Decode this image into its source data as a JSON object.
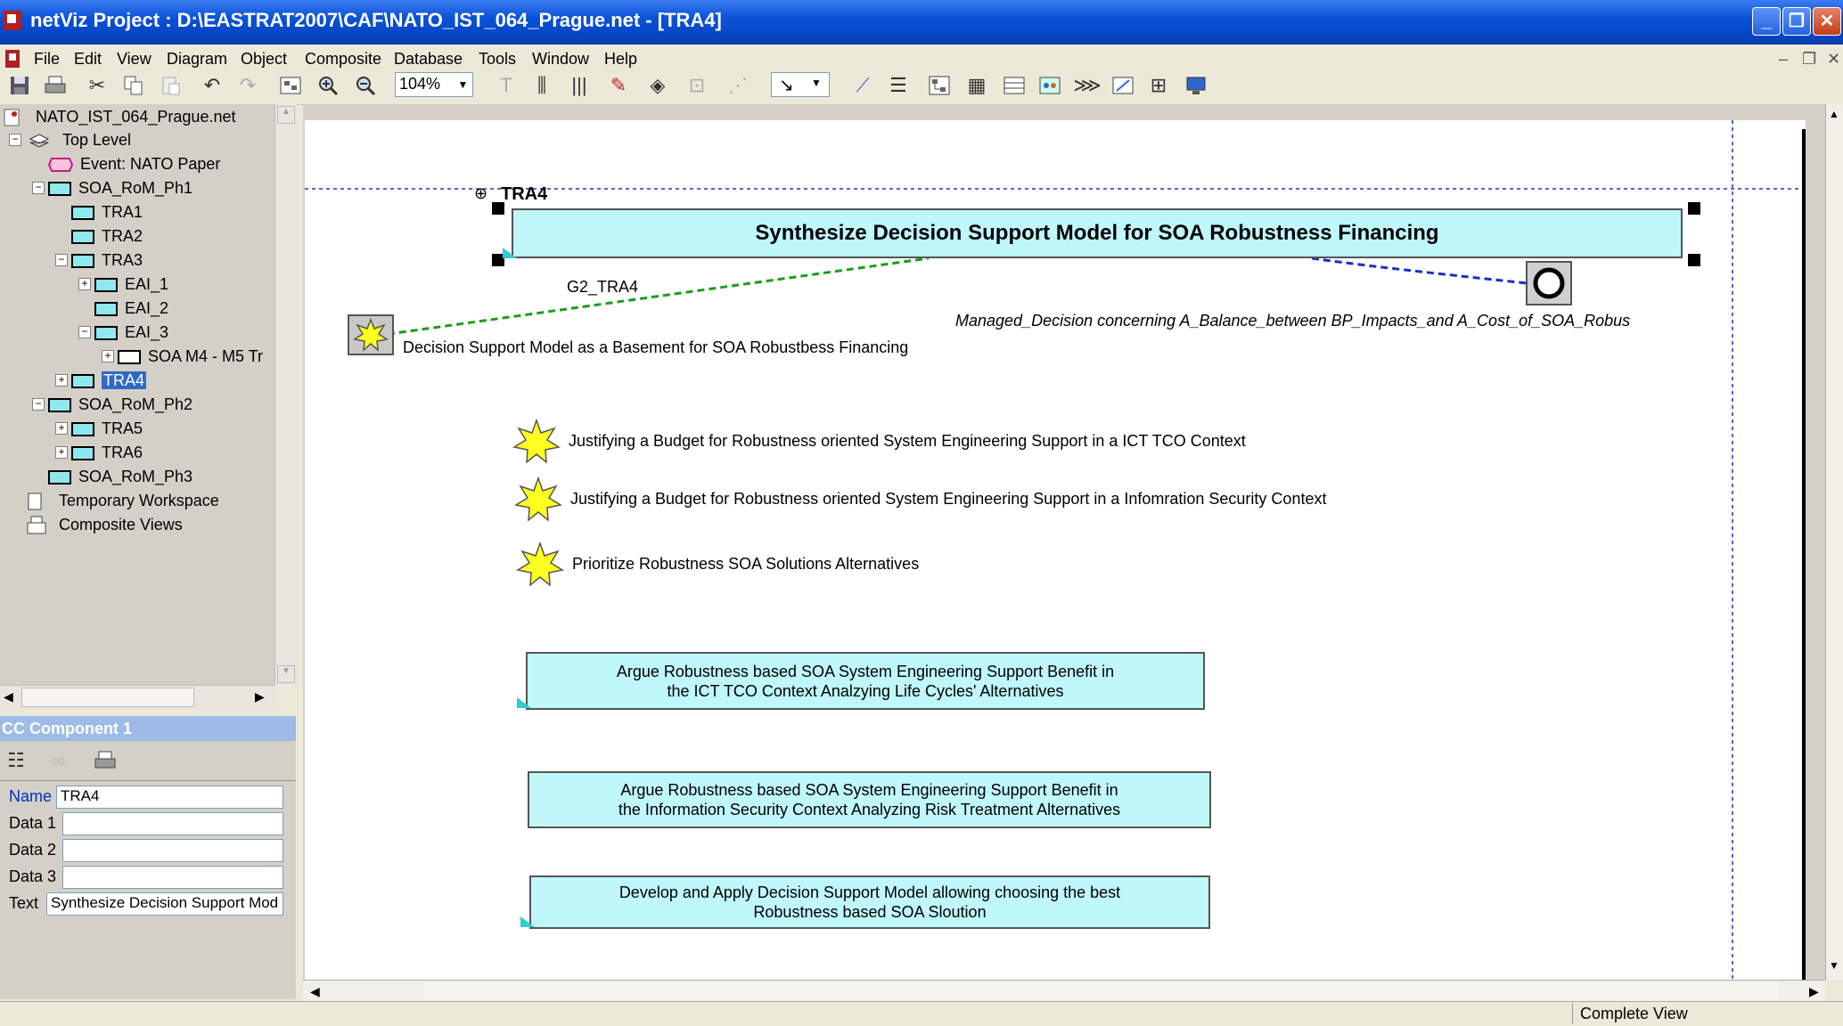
{
  "window": {
    "title": "netViz Project : D:\\EASTRAT2007\\CAF\\NATO_IST_064_Prague.net - [TRA4]",
    "controls": [
      "_",
      "❐",
      "✕"
    ]
  },
  "menu": [
    "File",
    "Edit",
    "View",
    "Diagram",
    "Object",
    "Composite",
    "Database",
    "Tools",
    "Window",
    "Help"
  ],
  "mdi_controls": [
    "–",
    "❐",
    "✕"
  ],
  "toolbar": {
    "zoom": "104%"
  },
  "tree": {
    "root": "NATO_IST_064_Prague.net",
    "items": [
      {
        "label": "Top Level"
      },
      {
        "label": "Event: NATO Paper"
      },
      {
        "label": "SOA_RoM_Ph1"
      },
      {
        "label": "TRA1"
      },
      {
        "label": "TRA2"
      },
      {
        "label": "TRA3"
      },
      {
        "label": "EAI_1"
      },
      {
        "label": "EAI_2"
      },
      {
        "label": "EAI_3"
      },
      {
        "label": "SOA M4 - M5 Tr"
      },
      {
        "label": "TRA4"
      },
      {
        "label": "SOA_RoM_Ph2"
      },
      {
        "label": "TRA5"
      },
      {
        "label": "TRA6"
      },
      {
        "label": "SOA_RoM_Ph3"
      },
      {
        "label": "Temporary Workspace"
      },
      {
        "label": "Composite Views"
      }
    ]
  },
  "properties": {
    "header": "CC Component 1",
    "name_label": "Name",
    "name_value": "TRA4",
    "data1_label": "Data 1",
    "data1_value": "",
    "data2_label": "Data 2",
    "data2_value": "",
    "data3_label": "Data 3",
    "data3_value": "",
    "text_label": "Text",
    "text_value": "Synthesize Decision Support Mod"
  },
  "diagram": {
    "node_label": "TRA4",
    "main_box": "Synthesize Decision Support Model for SOA Robustness Financing",
    "link_label": "G2_TRA4",
    "managed_decision": "Managed_Decision concerning A_Balance_between BP_Impacts_and A_Cost_of_SOA_Robus",
    "star_main_label": "Decision Support Model as a Basement for SOA Robustbess Financing",
    "stars": [
      "Justifying a Budget for Robustness oriented System Engineering Support in a ICT TCO Context",
      "Justifying a Budget for Robustness oriented System Engineering Support in a Infomration Security Context",
      "Prioritize  Robustness SOA Solutions Alternatives"
    ],
    "boxes": [
      {
        "line1": "Argue Robustness based SOA System Engineering Support Benefit in",
        "line2": "the  ICT TCO Context Analzying Life Cycles' Alternatives"
      },
      {
        "line1": "Argue Robustness based SOA System Engineering Support Benefit in",
        "line2": "the  Information Security Context Analyzing Risk Treatment Alternatives"
      },
      {
        "line1": "Develop and Apply Decision Support Model allowing choosing the best",
        "line2": "Robustness based SOA Sloution"
      }
    ]
  },
  "status": {
    "view": "Complete View"
  },
  "colors": {
    "box_fill": "#bff7fb",
    "star_fill": "#ffff20",
    "link_green": "#1a9e1a",
    "link_blue": "#1a2ec8",
    "selection": "#316ac5"
  },
  "icons": [
    "save-icon",
    "print-icon",
    "cut-icon",
    "copy-icon",
    "paste-icon",
    "undo-icon",
    "redo-icon",
    "zoom-in-icon",
    "zoom-out-icon"
  ]
}
